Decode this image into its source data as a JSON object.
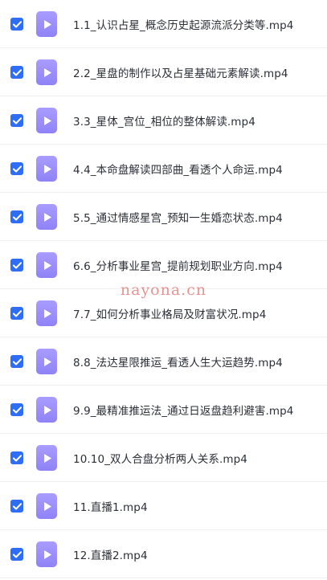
{
  "files": [
    {
      "name": "1.1_认识占星_概念历史起源流派分类等.mp4",
      "checked": true
    },
    {
      "name": "2.2_星盘的制作以及占星基础元素解读.mp4",
      "checked": true
    },
    {
      "name": "3.3_星体_宫位_相位的整体解读.mp4",
      "checked": true
    },
    {
      "name": "4.4_本命盘解读四部曲_看透个人命运.mp4",
      "checked": true
    },
    {
      "name": "5.5_通过情感星宫_预知一生婚恋状态.mp4",
      "checked": true
    },
    {
      "name": "6.6_分析事业星宫_提前规划职业方向.mp4",
      "checked": true
    },
    {
      "name": "7.7_如何分析事业格局及财富状况.mp4",
      "checked": true
    },
    {
      "name": "8.8_法达星限推运_看透人生大运趋势.mp4",
      "checked": true
    },
    {
      "name": "9.9_最精准推运法_通过日返盘趋利避害.mp4",
      "checked": true
    },
    {
      "name": "10.10_双人合盘分析两人关系.mp4",
      "checked": true
    },
    {
      "name": "11.直播1.mp4",
      "checked": true
    },
    {
      "name": "12.直播2.mp4",
      "checked": true
    }
  ],
  "icons": {
    "checkbox": "checkbox-checked-icon",
    "file": "video-file-icon"
  },
  "colors": {
    "checkbox": "#2f6df6",
    "file_icon": "#9b8ef8",
    "text": "#2b2f36",
    "watermark": "#d63a3a"
  },
  "watermark": "nayona.cn"
}
